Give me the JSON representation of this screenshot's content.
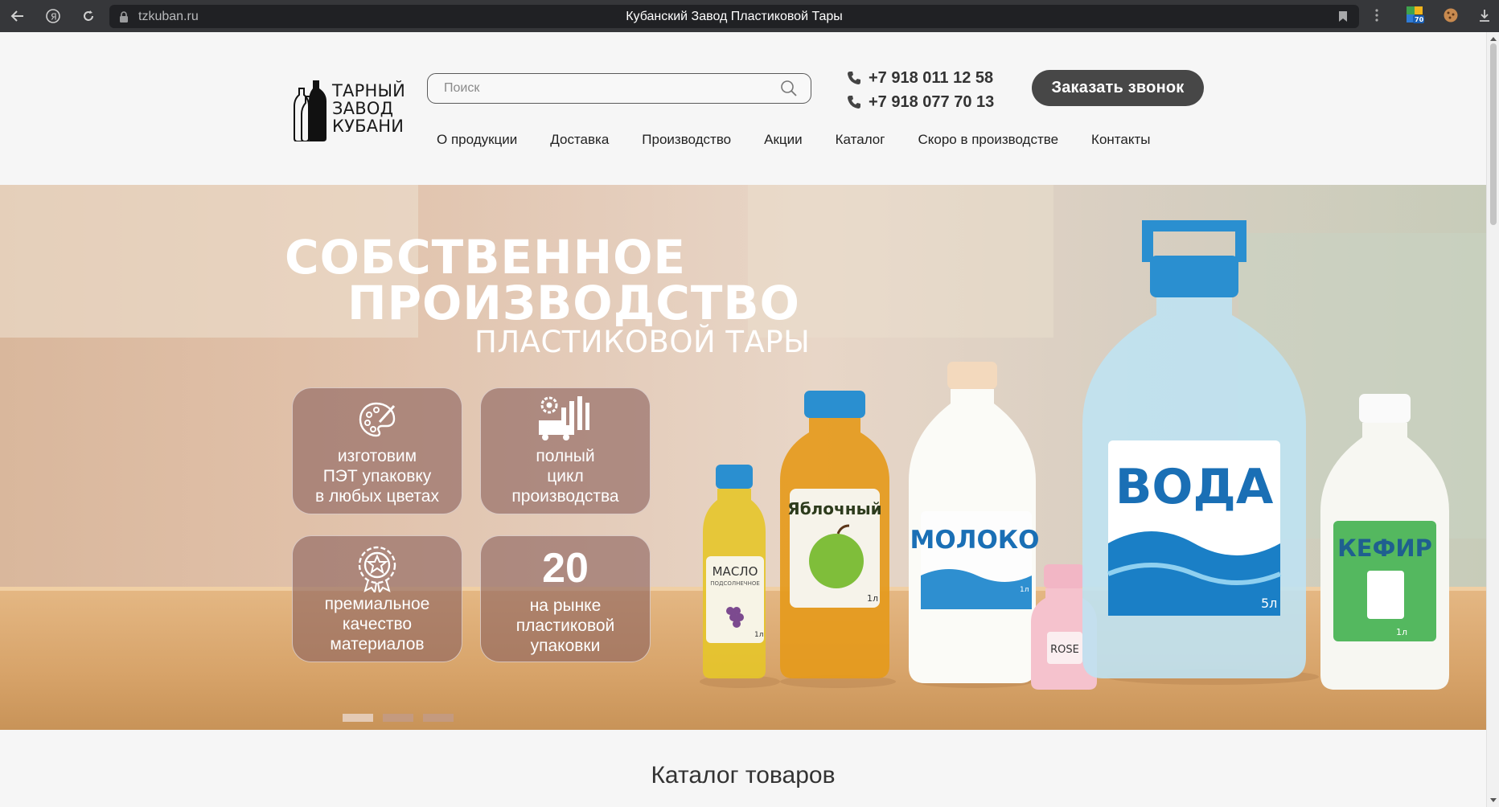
{
  "browser": {
    "url": "tzkuban.ru",
    "tab_title": "Кубанский Завод Пластиковой Тары",
    "extension_badge": "70"
  },
  "header": {
    "logo_line1": "ТАРНЫЙ",
    "logo_line2": "ЗАВОД",
    "logo_line3": "КУБАНИ",
    "search_placeholder": "Поиск",
    "phones": [
      "+7 918 011 12 58",
      "+7 918 077 70 13"
    ],
    "cta_label": "Заказать звонок"
  },
  "menu": [
    "О продукции",
    "Доставка",
    "Производство",
    "Акции",
    "Каталог",
    "Скоро в производстве",
    "Контакты"
  ],
  "hero": {
    "title_line1": "СОБСТВЕННОЕ",
    "title_line2": "ПРОИЗВОДСТВО",
    "subtitle": "ПЛАСТИКОВОЙ ТАРЫ",
    "features": [
      {
        "icon": "palette-icon",
        "lines": [
          "изготовим",
          "ПЭТ упаковку",
          "в любых цветах"
        ]
      },
      {
        "icon": "factory-icon",
        "lines": [
          "полный",
          "цикл",
          "производства"
        ]
      },
      {
        "icon": "award-icon",
        "lines": [
          "премиальное",
          "качество",
          "материалов"
        ]
      },
      {
        "number": "20",
        "lines": [
          "на рынке",
          "пластиковой",
          "упаковки"
        ]
      }
    ],
    "slides_total": 3,
    "slide_active": 1,
    "bottle_labels": {
      "oil": "МАСЛО",
      "oil_sub": "ПОДСОЛНЕЧНОЕ",
      "oil_volume": "1л",
      "juice": "Яблочный",
      "juice_volume": "1л",
      "milk": "МОЛОКО",
      "milk_volume": "1л",
      "small": "ROSE",
      "water": "ВОДА",
      "water_volume": "5л",
      "kefir": "КЕФИР",
      "kefir_volume": "1л"
    }
  },
  "catalog": {
    "title": "Каталог товаров"
  },
  "colors": {
    "accent_dark": "#474747",
    "feature_bg": "#8d625e",
    "cap_blue": "#2a8fd0",
    "water_blue": "#1a6fb5"
  }
}
